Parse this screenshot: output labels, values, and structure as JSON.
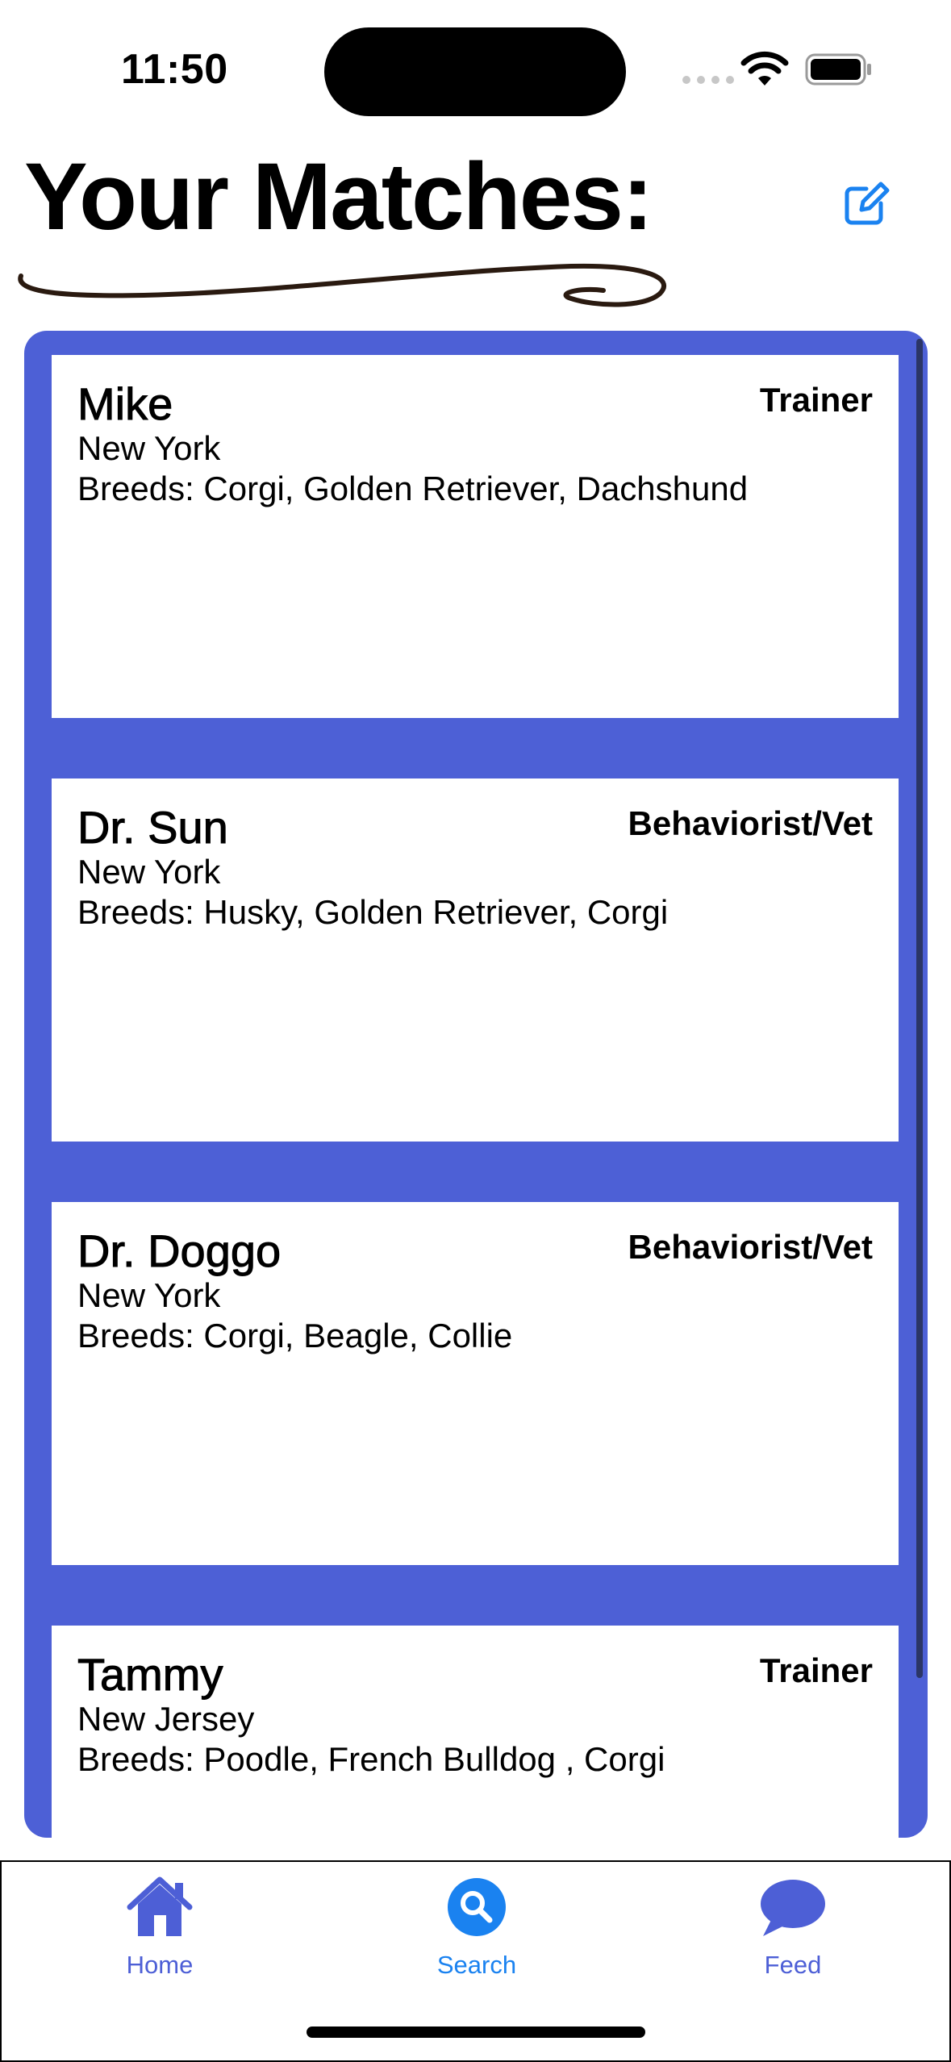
{
  "status_bar": {
    "time": "11:50"
  },
  "header": {
    "title": "Your Matches:",
    "edit_icon": "square-pencil-icon"
  },
  "colors": {
    "accent": "#4d60d6",
    "tint": "#1a82f0",
    "card": "#ffffff"
  },
  "matches": [
    {
      "name": "Mike",
      "role": "Trainer",
      "location": "New York",
      "breeds": "Breeds: Corgi, Golden Retriever, Dachshund"
    },
    {
      "name": "Dr. Sun",
      "role": "Behaviorist/Vet",
      "location": "New York",
      "breeds": "Breeds: Husky, Golden Retriever, Corgi"
    },
    {
      "name": "Dr. Doggo",
      "role": "Behaviorist/Vet",
      "location": "New York",
      "breeds": "Breeds: Corgi, Beagle, Collie"
    },
    {
      "name": "Tammy",
      "role": "Trainer",
      "location": "New Jersey",
      "breeds": "Breeds: Poodle, French Bulldog , Corgi"
    }
  ],
  "tab_bar": {
    "items": [
      {
        "label": "Home",
        "icon": "house-icon",
        "selected": false
      },
      {
        "label": "Search",
        "icon": "magnifying-glass-circle-icon",
        "selected": true
      },
      {
        "label": "Feed",
        "icon": "speech-bubble-icon",
        "selected": false
      }
    ]
  }
}
